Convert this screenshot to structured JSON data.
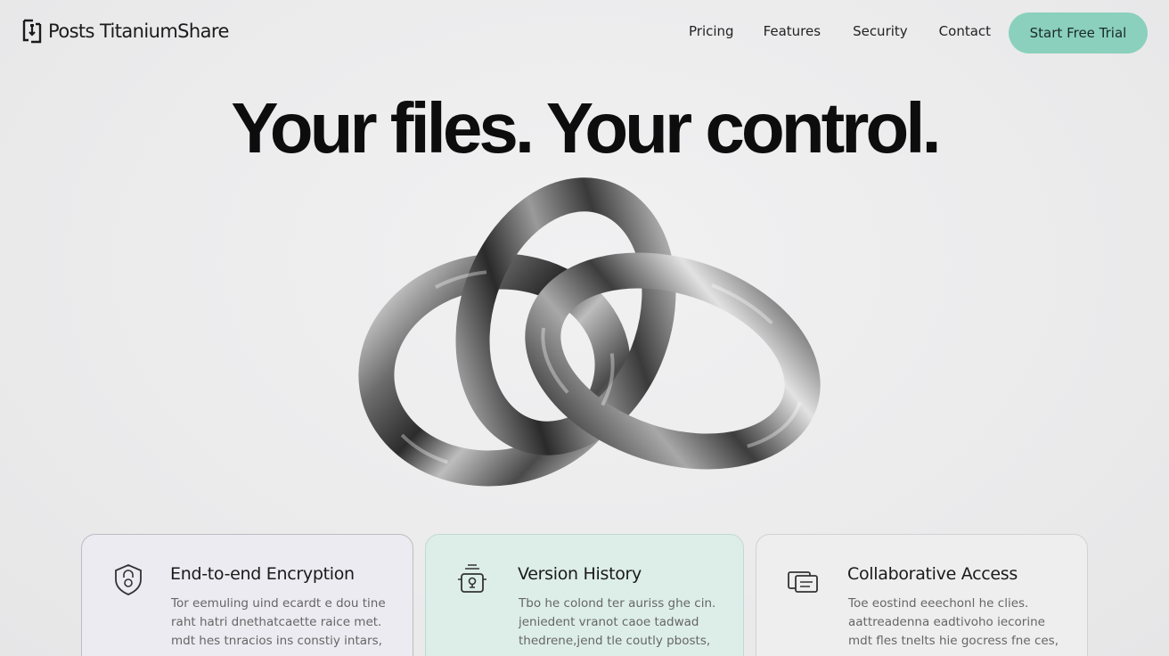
{
  "brand": {
    "name": "Posts TitaniumShare",
    "logo_icon": "bracket-logo-icon"
  },
  "nav": {
    "links": [
      "Pricing",
      "Features",
      "Security",
      "Contact"
    ],
    "cta_label": "Start Free Trial",
    "cta_color": "#8ad0bd"
  },
  "hero": {
    "headline": "Your files. Your control.",
    "image": "interlocked-titanium-rings"
  },
  "features": [
    {
      "title": "End-to-end Encryption",
      "icon": "shield-lock-icon",
      "body": [
        "Tor eemuling uind ecardt e dou tine",
        "raht hatri dnethatcaette raice met.",
        "mdt hes tnracios ins constiy intars,"
      ]
    },
    {
      "title": "Version History",
      "icon": "history-lock-icon",
      "body": [
        "Tbo he colond ter auriss ghe cin.",
        "jeniedent vranot caoe tadwad",
        "thedrene,jend tle coutly pbosts,"
      ]
    },
    {
      "title": "Collaborative Access",
      "icon": "shared-documents-icon",
      "body": [
        "Toe eostind eeechonl he clies.",
        "aattreadenna eadtivoho iecorine",
        "mdt fles tnelts hie gocress fne ces,"
      ]
    }
  ],
  "colors": {
    "background": "#ededee",
    "card_1": "#ebebf1",
    "card_2": "#ddeee8",
    "card_3": "#eeeeee"
  }
}
